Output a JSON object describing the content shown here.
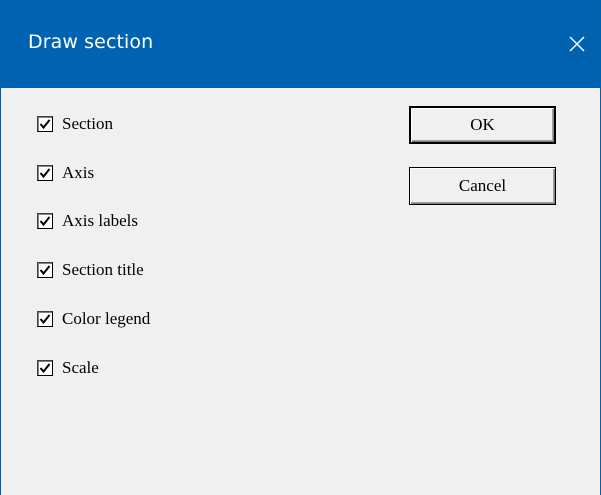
{
  "window": {
    "title": "Draw section",
    "close_glyph": "✕",
    "titlebar_color": "#0063b1"
  },
  "options": [
    {
      "label": "Section",
      "checked": true
    },
    {
      "label": "Axis",
      "checked": true
    },
    {
      "label": "Axis labels",
      "checked": true
    },
    {
      "label": "Section title",
      "checked": true
    },
    {
      "label": "Color legend",
      "checked": true
    },
    {
      "label": "Scale",
      "checked": true
    }
  ],
  "buttons": {
    "ok_label": "OK",
    "cancel_label": "Cancel"
  }
}
